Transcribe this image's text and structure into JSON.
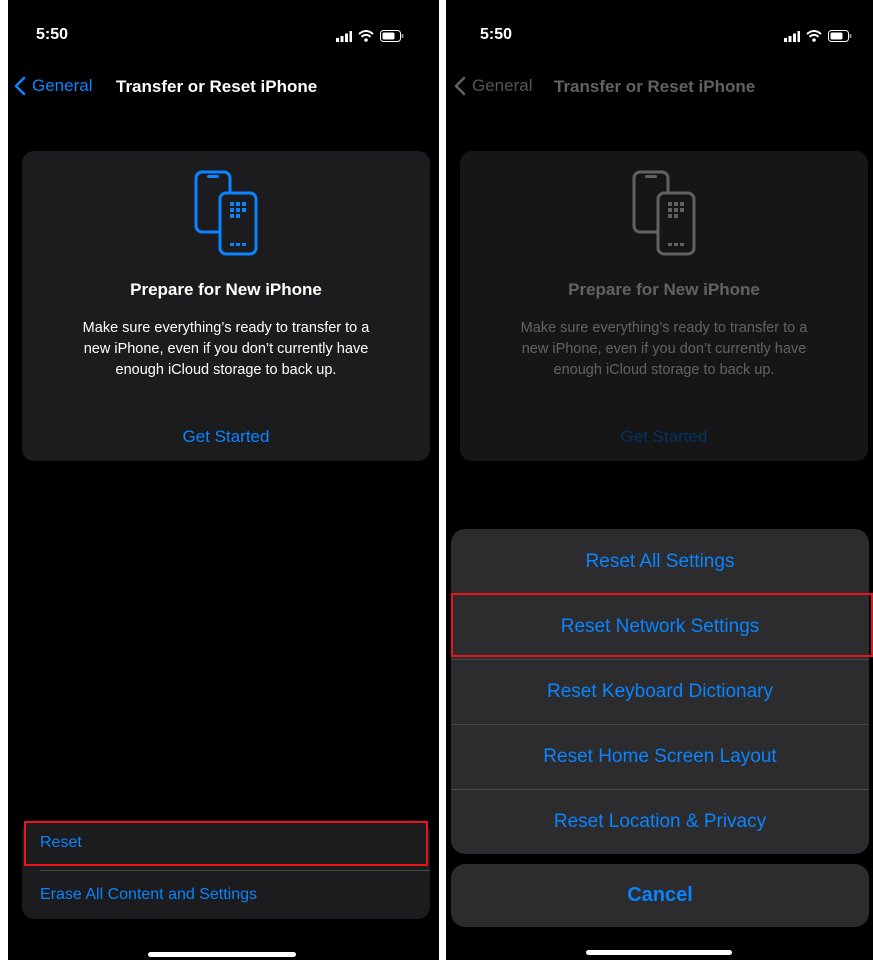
{
  "left": {
    "status_time": "5:50",
    "back_label": "General",
    "title": "Transfer or Reset iPhone",
    "card": {
      "title": "Prepare for New iPhone",
      "description_lines": [
        "Make sure everything’s ready to transfer to a",
        "new iPhone, even if you don’t currently have",
        "enough iCloud storage to back up."
      ],
      "link": "Get Started"
    },
    "list": [
      {
        "label": "Reset"
      },
      {
        "label": "Erase All Content and Settings"
      }
    ]
  },
  "right": {
    "status_time": "5:50",
    "back_label": "General",
    "title": "Transfer or Reset iPhone",
    "card": {
      "title": "Prepare for New iPhone",
      "description_lines": [
        "Make sure everything’s ready to transfer to a",
        "new iPhone, even if you don’t currently have",
        "enough iCloud storage to back up."
      ],
      "link": "Get Started"
    },
    "sheet": {
      "options": [
        {
          "label": "Reset All Settings"
        },
        {
          "label": "Reset Network Settings"
        },
        {
          "label": "Reset Keyboard Dictionary"
        },
        {
          "label": "Reset Home Screen Layout"
        },
        {
          "label": "Reset Location & Privacy"
        }
      ],
      "cancel": "Cancel"
    }
  },
  "colors": {
    "accent": "#0a84ff",
    "highlight": "#e8141c",
    "background": "#000000",
    "card": "#1c1c1e",
    "sheet": "#2c2c2e"
  },
  "icons": [
    "chevron-left-icon",
    "signal-icon",
    "wifi-icon",
    "battery-icon",
    "transfer-phones-icon"
  ]
}
